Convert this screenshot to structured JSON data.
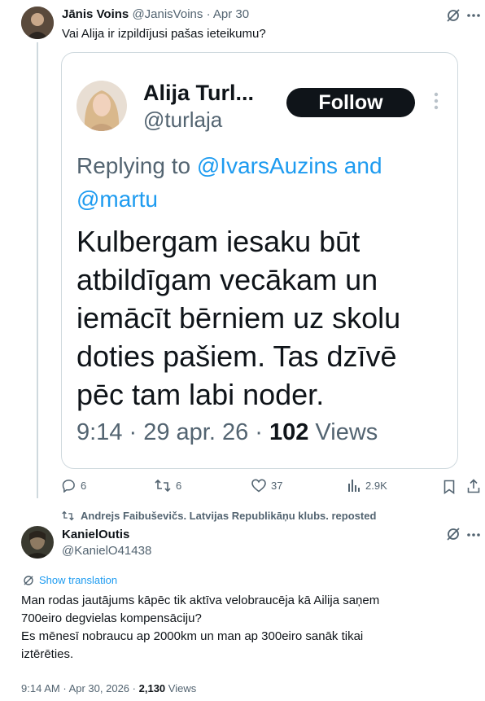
{
  "tweet1": {
    "name": "Jānis Voins",
    "handle": "@JanisVoins",
    "sep": "·",
    "date": "Apr 30",
    "text": "Vai Alija ir izpildījusi pašas ieteikumu?"
  },
  "quoted": {
    "name": "Alija Turl...",
    "handle": "@turlaja",
    "follow_label": "Follow",
    "replying_prefix": "Replying to ",
    "reply_mention1": "@IvarsAuzins and",
    "reply_mention2": "@martu",
    "body_lines": [
      "Kulbergam iesaku būt",
      "atbildīgam vecākam un",
      "iemācīt bērniem uz skolu",
      "doties pašiem. Tas dzīvē",
      "pēc tam labi noder."
    ],
    "meta_time": "9:14 · 29 apr. 26 · ",
    "meta_views_num": "102",
    "meta_views_label": " Views"
  },
  "actions": {
    "replies": "6",
    "reposts": "6",
    "likes": "37",
    "views": "2.9K"
  },
  "repost_banner": "Andrejs Faibuševičs. Latvijas Republikāņu klubs. reposted",
  "tweet2": {
    "name": "KanielOutis",
    "handle": "@KanielO41438",
    "show_translation": "Show translation",
    "text_lines": [
      "Man rodas jautājums kāpēc tik aktīva velobraucēja kā Ailija saņem",
      "700eiro degvielas kompensāciju?",
      "Es mēnesī nobraucu ap 2000km un man ap 300eiro sanāk tikai",
      "iztērēties."
    ],
    "time": "9:14 AM",
    "sep": "·",
    "date": "Apr 30, 2026",
    "sep2": "·",
    "views_num": "2,130",
    "views_label": "Views"
  },
  "colors": {
    "accent": "#1d9bf0",
    "muted": "#536471",
    "border": "#cfd9de"
  }
}
